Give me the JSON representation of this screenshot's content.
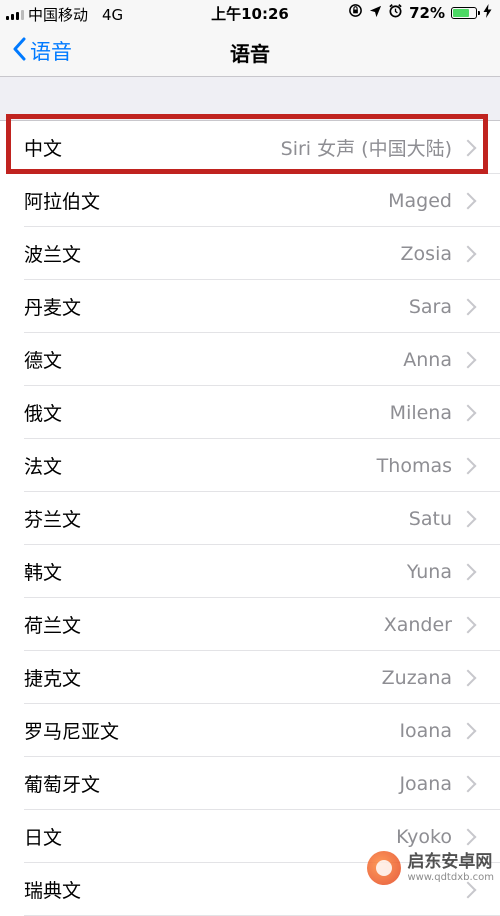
{
  "status_bar": {
    "carrier": "中国移动",
    "network": "4G",
    "time": "上午10:26",
    "battery": "72%",
    "battery_level": 0.72
  },
  "nav": {
    "back_label": "语音",
    "title": "语音"
  },
  "rows": [
    {
      "label": "中文",
      "value": "Siri 女声 (中国大陆)"
    },
    {
      "label": "阿拉伯文",
      "value": "Maged"
    },
    {
      "label": "波兰文",
      "value": "Zosia"
    },
    {
      "label": "丹麦文",
      "value": "Sara"
    },
    {
      "label": "德文",
      "value": "Anna"
    },
    {
      "label": "俄文",
      "value": "Milena"
    },
    {
      "label": "法文",
      "value": "Thomas"
    },
    {
      "label": "芬兰文",
      "value": "Satu"
    },
    {
      "label": "韩文",
      "value": "Yuna"
    },
    {
      "label": "荷兰文",
      "value": "Xander"
    },
    {
      "label": "捷克文",
      "value": "Zuzana"
    },
    {
      "label": "罗马尼亚文",
      "value": "Ioana"
    },
    {
      "label": "葡萄牙文",
      "value": "Joana"
    },
    {
      "label": "日文",
      "value": "Kyoko"
    },
    {
      "label": "瑞典文",
      "value": ""
    }
  ],
  "watermark": {
    "name": "启东安卓网",
    "url": "www.qdtdxb.com"
  },
  "colors": {
    "accent": "#007aff",
    "highlight": "#c0231f",
    "battery": "#4cd964"
  }
}
